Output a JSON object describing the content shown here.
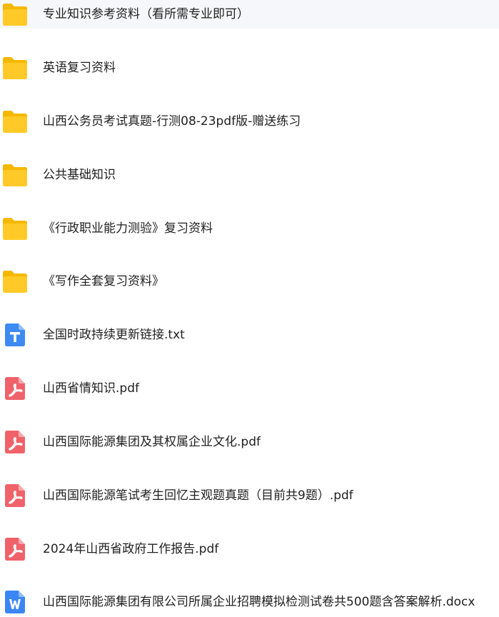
{
  "files": [
    {
      "name": "专业知识参考资料（看所需专业即可）",
      "type": "folder",
      "icon": "folder-icon"
    },
    {
      "name": "英语复习资料",
      "type": "folder",
      "icon": "folder-icon"
    },
    {
      "name": "山西公务员考试真题-行测08-23pdf版-赠送练习",
      "type": "folder",
      "icon": "folder-icon"
    },
    {
      "name": "公共基础知识",
      "type": "folder",
      "icon": "folder-icon"
    },
    {
      "name": "《行政职业能力测验》复习资料",
      "type": "folder",
      "icon": "folder-icon"
    },
    {
      "name": "《写作全套复习资料》",
      "type": "folder",
      "icon": "folder-icon"
    },
    {
      "name": "全国时政持续更新链接.txt",
      "type": "txt",
      "icon": "text-file-icon"
    },
    {
      "name": "山西省情知识.pdf",
      "type": "pdf",
      "icon": "pdf-file-icon"
    },
    {
      "name": "山西国际能源集团及其权属企业文化.pdf",
      "type": "pdf",
      "icon": "pdf-file-icon"
    },
    {
      "name": "山西国际能源笔试考生回忆主观题真题（目前共9题）.pdf",
      "type": "pdf",
      "icon": "pdf-file-icon"
    },
    {
      "name": "2024年山西省政府工作报告.pdf",
      "type": "pdf",
      "icon": "pdf-file-icon"
    },
    {
      "name": "山西国际能源集团有限公司所属企业招聘模拟检测试卷共500题含答案解析.docx",
      "type": "docx",
      "icon": "word-file-icon"
    }
  ],
  "colors": {
    "folder_back": "#f5b800",
    "folder_front": "#ffca28",
    "txt": "#3d8bf2",
    "pdf": "#f0626a",
    "docx": "#3b86f5"
  }
}
